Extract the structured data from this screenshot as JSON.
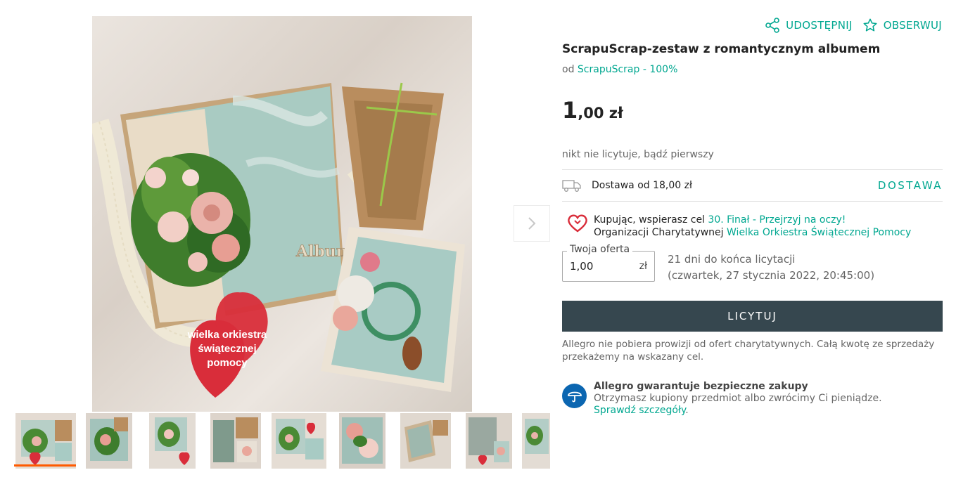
{
  "actions": {
    "share_label": "UDOSTĘPNIJ",
    "watch_label": "OBSERWUJ"
  },
  "product": {
    "title": "ScrapuScrap-zestaw z romantycznym albumem",
    "seller_prefix": "od",
    "seller_name": "ScrapuScrap - 100%",
    "price_int": "1",
    "price_rest": ",00 zł",
    "bids_status": "nikt nie licytuje, bądź pierwszy"
  },
  "delivery": {
    "text": "Dostawa od 18,00 zł",
    "link": "DOSTAWA"
  },
  "charity": {
    "line1_prefix": "Kupując, wspierasz cel",
    "line1_link": "30. Finał - Przejrzyj na oczy!",
    "line2_prefix": "Organizacji Charytatywnej",
    "line2_link": "Wielka Orkiestra Świątecznej Pomocy"
  },
  "offer": {
    "label": "Twoja oferta",
    "value": "1,00",
    "unit": "zł",
    "remaining": "21 dni do końca licytacji",
    "end_date": "(czwartek, 27 stycznia 2022, 20:45:00)"
  },
  "bid_button": "LICYTUJ",
  "note": "Allegro nie pobiera prowizji od ofert charytatywnych. Całą kwotę ze sprzedaży przekażemy na wskazany cel.",
  "guarantee": {
    "title": "Allegro gwarantuje bezpieczne zakupy",
    "text": "Otrzymasz kupiony przedmiot albo zwrócimy Ci pieniądze.",
    "link": "Sprawdź szczegóły"
  },
  "image": {
    "heart_line1": "wielka orkiestra",
    "heart_line2": "świątecznej",
    "heart_line3": "pomocy",
    "album_text": "Album"
  },
  "colors": {
    "accent": "#00a790",
    "button": "#36474f",
    "active_thumb": "#ff5a00",
    "heart": "#d92d3a",
    "guarantee": "#0b66b1"
  }
}
